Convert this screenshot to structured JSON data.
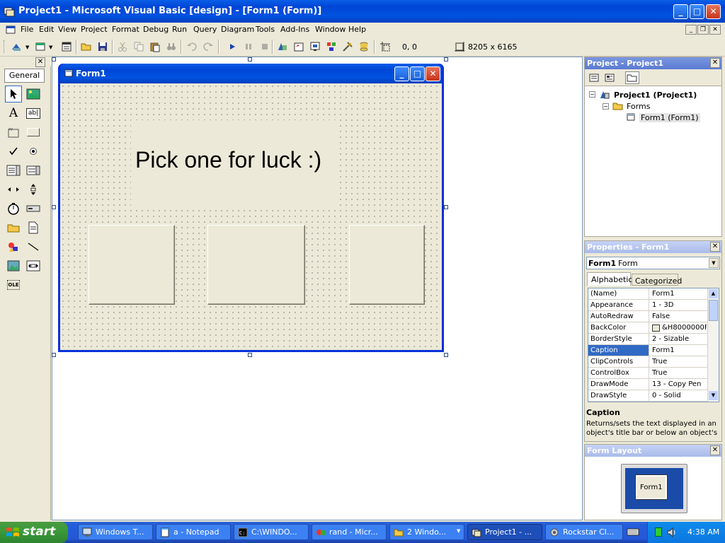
{
  "window": {
    "title": "Project1 - Microsoft Visual Basic [design] - [Form1 (Form)]"
  },
  "menu": {
    "items": [
      "File",
      "Edit",
      "View",
      "Project",
      "Format",
      "Debug",
      "Run",
      "Query",
      "Diagram",
      "Tools",
      "Add-Ins",
      "Window",
      "Help"
    ]
  },
  "toolbar": {
    "position": "0, 0",
    "size": "8205 x 6165"
  },
  "toolbox": {
    "tab_label": "General"
  },
  "form": {
    "title": "Form1",
    "label_text": "Pick one for luck :)"
  },
  "project_panel": {
    "title": "Project - Project1",
    "root": "Project1 (Project1)",
    "folder": "Forms",
    "item": "Form1 (Form1)"
  },
  "properties_panel": {
    "title": "Properties - Form1",
    "object_name": "Form1",
    "object_type": "Form",
    "tabs": [
      "Alphabetic",
      "Categorized"
    ],
    "rows": [
      {
        "name": "(Name)",
        "value": "Form1"
      },
      {
        "name": "Appearance",
        "value": "1 - 3D"
      },
      {
        "name": "AutoRedraw",
        "value": "False"
      },
      {
        "name": "BackColor",
        "value": "&H8000000F"
      },
      {
        "name": "BorderStyle",
        "value": "2 - Sizable"
      },
      {
        "name": "Caption",
        "value": "Form1"
      },
      {
        "name": "ClipControls",
        "value": "True"
      },
      {
        "name": "ControlBox",
        "value": "True"
      },
      {
        "name": "DrawMode",
        "value": "13 - Copy Pen"
      },
      {
        "name": "DrawStyle",
        "value": "0 - Solid"
      }
    ],
    "description_title": "Caption",
    "description_text": "Returns/sets the text displayed in an object's title bar or below an object's"
  },
  "form_layout_panel": {
    "title": "Form Layout",
    "preview_label": "Form1"
  },
  "taskbar": {
    "start_label": "start",
    "tasks": [
      "Windows T...",
      "a - Notepad",
      "C:\\WINDO...",
      "rand - Micr...",
      "2 Windo...",
      "Project1 - ...",
      "Rockstar Cl..."
    ],
    "clock": "4:38 AM"
  },
  "colors": {
    "title_blue": "#0054e3",
    "selection": "#316ac5",
    "start_green": "#3c9a3c"
  }
}
